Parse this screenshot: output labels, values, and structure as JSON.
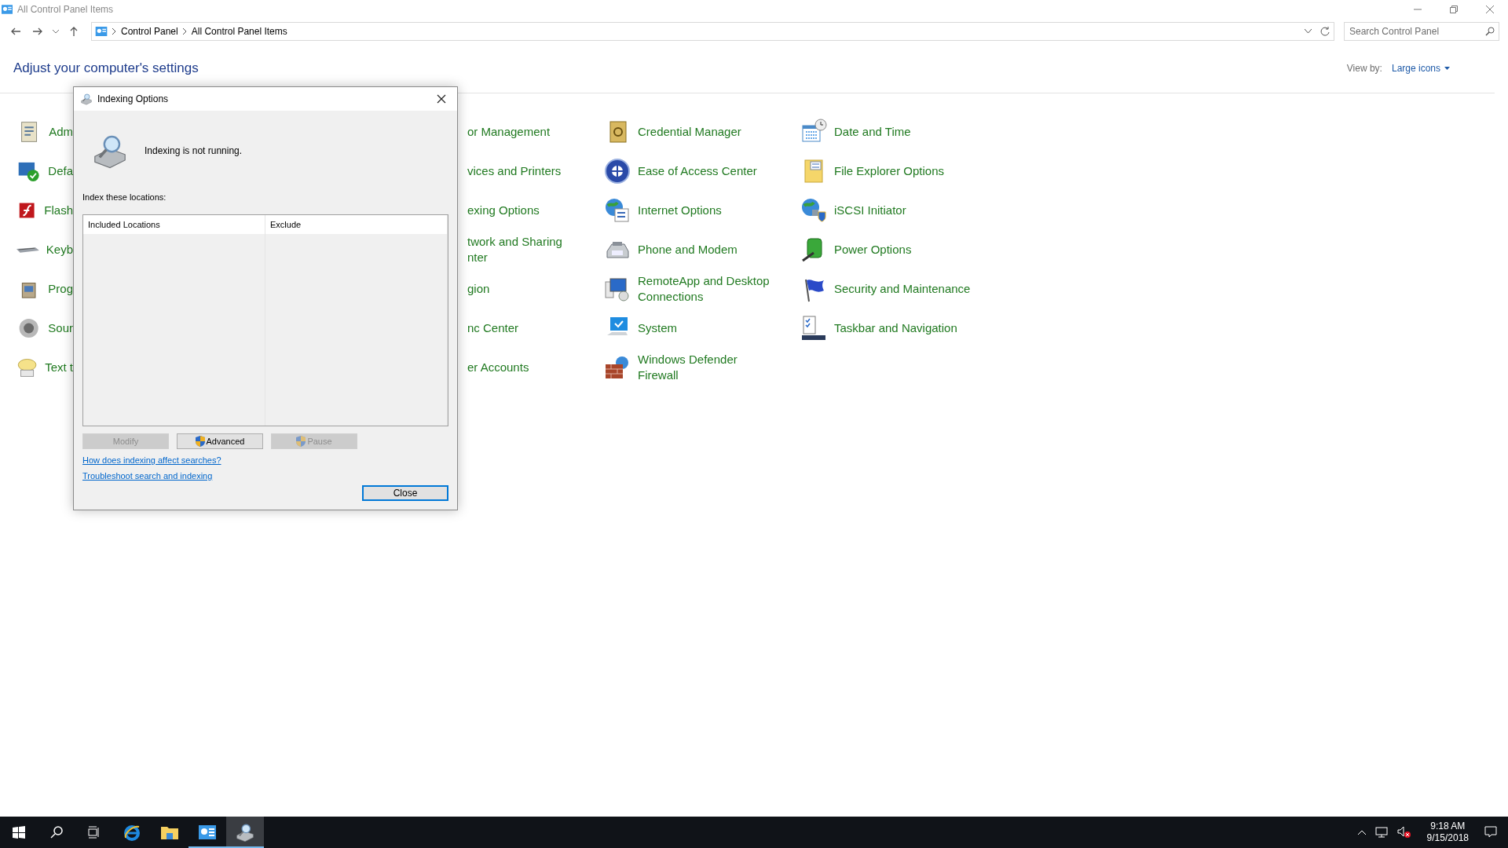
{
  "window": {
    "title": "All Control Panel Items"
  },
  "address_bar": {
    "path": [
      "Control Panel",
      "All Control Panel Items"
    ]
  },
  "search": {
    "placeholder": "Search Control Panel"
  },
  "heading": "Adjust your computer's settings",
  "view_by": {
    "label": "View by:",
    "value": "Large icons"
  },
  "columns": [
    {
      "items": [
        "Adm",
        "Defa",
        "Flash",
        "Keyb",
        "Prog",
        "Sour",
        "Text t"
      ]
    },
    {
      "items": [
        "or Management",
        "vices and Printers",
        "exing Options",
        "twork and Sharing\nnter",
        "gion",
        "nc Center",
        "er Accounts"
      ]
    },
    {
      "items": [
        "Credential Manager",
        "Ease of Access Center",
        "Internet Options",
        "Phone and Modem",
        "RemoteApp and Desktop\nConnections",
        "System",
        "Windows Defender\nFirewall"
      ]
    },
    {
      "items": [
        "Date and Time",
        "File Explorer Options",
        "iSCSI Initiator",
        "Power Options",
        "Security and Maintenance",
        "Taskbar and Navigation"
      ]
    }
  ],
  "dialog": {
    "title": "Indexing Options",
    "status": "Indexing is not running.",
    "locations_label": "Index these locations:",
    "table": {
      "columns": [
        "Included Locations",
        "Exclude"
      ]
    },
    "buttons": [
      {
        "label": "Modify",
        "disabled": true,
        "shield": false
      },
      {
        "label": "Advanced",
        "disabled": false,
        "shield": true
      },
      {
        "label": "Pause",
        "disabled": true,
        "shield": true
      }
    ],
    "links": [
      "How does indexing affect searches?",
      "Troubleshoot search and indexing"
    ],
    "close_button": "Close"
  },
  "taskbar": {
    "apps": [
      {
        "running": false,
        "selected": false
      },
      {
        "running": false,
        "selected": false
      },
      {
        "running": false,
        "selected": false
      },
      {
        "running": false,
        "selected": false
      },
      {
        "running": false,
        "selected": false
      },
      {
        "running": true,
        "selected": false
      },
      {
        "running": true,
        "selected": true
      }
    ]
  },
  "clock": {
    "time": "9:18 AM",
    "date": "9/15/2018"
  }
}
